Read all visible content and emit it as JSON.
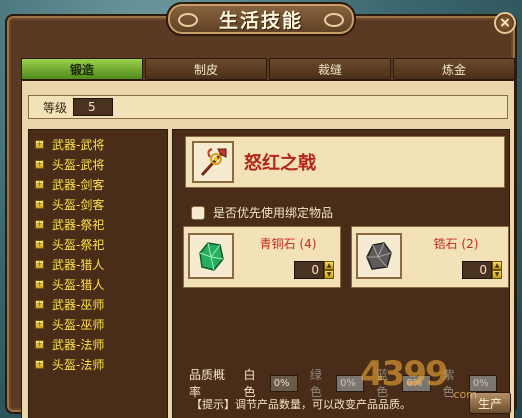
{
  "window": {
    "title": "生活技能",
    "close_glyph": "×"
  },
  "tabs": [
    {
      "label": "锻造",
      "active": true
    },
    {
      "label": "制皮",
      "active": false
    },
    {
      "label": "裁缝",
      "active": false
    },
    {
      "label": "炼金",
      "active": false
    }
  ],
  "level": {
    "label": "等级",
    "value": "5"
  },
  "recipes": [
    "武器-武将",
    "头盔-武将",
    "武器-剑客",
    "头盔-剑客",
    "武器-祭祀",
    "头盔-祭祀",
    "武器-猎人",
    "头盔-猎人",
    "武器-巫师",
    "头盔-巫师",
    "武器-法师",
    "头盔-法师"
  ],
  "product": {
    "name": "怒红之戟",
    "icon": "halberd-icon"
  },
  "bind_option": {
    "label": "是否优先使用绑定物品",
    "checked": false
  },
  "materials": [
    {
      "name": "青铜石 (4)",
      "quantity": "0",
      "icon": "green-gem-icon"
    },
    {
      "name": "锆石 (2)",
      "quantity": "0",
      "icon": "dark-ore-icon"
    }
  ],
  "quality": {
    "title": "品质概率",
    "levels": [
      {
        "label": "白色",
        "value": "0%",
        "dim": false
      },
      {
        "label": "绿色",
        "value": "0%",
        "dim": true
      },
      {
        "label": "蓝色",
        "value": "0%",
        "dim": true
      },
      {
        "label": "紫色",
        "value": "0%",
        "dim": true
      }
    ]
  },
  "hint": "【提示】调节产品数量，可以改变产品品质。",
  "produce_button": "生产",
  "watermark": {
    "main": "4399",
    "sub": ".com"
  },
  "colors": {
    "recipe_text": "#ffe14a",
    "product_name": "#b4261a",
    "material_name": "#c42d1f",
    "active_tab": "#4f8a1d"
  }
}
